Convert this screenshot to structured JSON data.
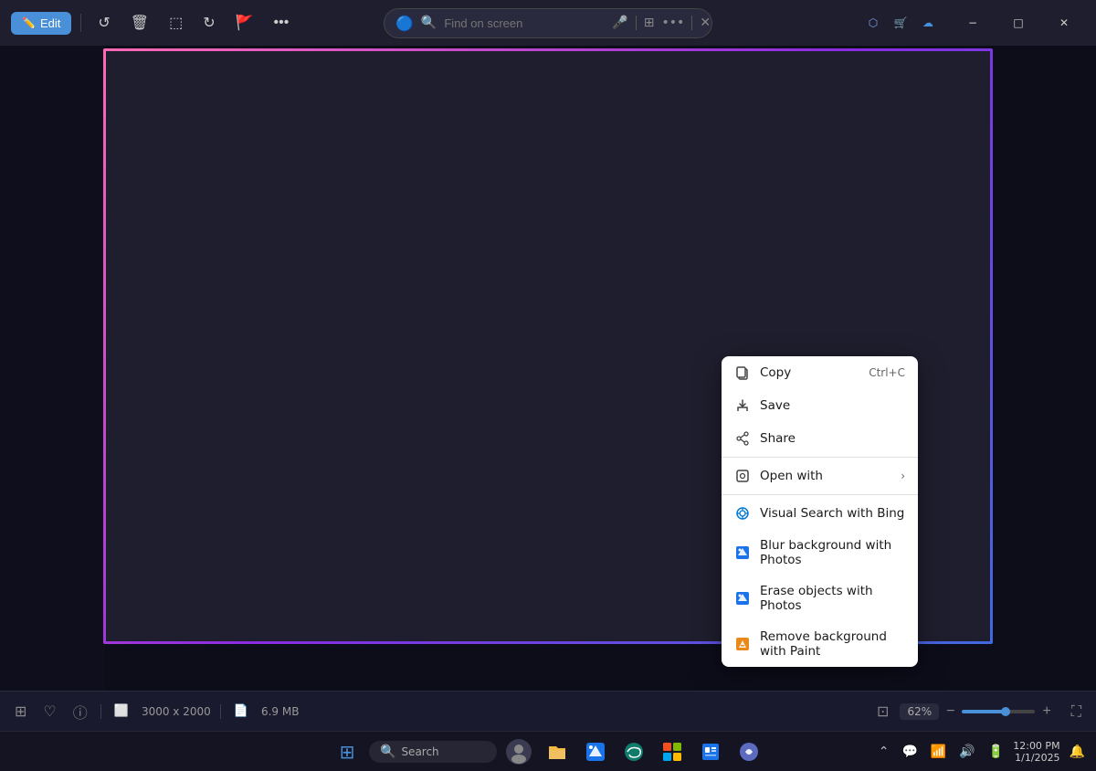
{
  "titlebar": {
    "edit_label": "Edit",
    "search_placeholder": "Find on screen",
    "toolbar_icons": [
      "rotate-left",
      "delete",
      "crop",
      "rotate-right",
      "flag",
      "more"
    ]
  },
  "window_controls": {
    "minimize": "−",
    "restore": "□",
    "close": "✕"
  },
  "statusbar": {
    "dimensions": "3000 x 2000",
    "filesize": "6.9 MB",
    "zoom_value": "62%"
  },
  "context_menu": {
    "items": [
      {
        "id": "copy",
        "label": "Copy",
        "shortcut": "Ctrl+C",
        "icon": "copy-icon"
      },
      {
        "id": "save",
        "label": "Save",
        "shortcut": "",
        "icon": "save-icon"
      },
      {
        "id": "share",
        "label": "Share",
        "shortcut": "",
        "icon": "share-icon"
      },
      {
        "id": "open-with",
        "label": "Open with",
        "shortcut": "",
        "icon": "open-with-icon",
        "arrow": "›"
      },
      {
        "id": "visual-search",
        "label": "Visual Search with Bing",
        "shortcut": "",
        "icon": "bing-icon"
      },
      {
        "id": "blur-bg",
        "label": "Blur background with Photos",
        "shortcut": "",
        "icon": "photos-icon"
      },
      {
        "id": "erase-objects",
        "label": "Erase objects with Photos",
        "shortcut": "",
        "icon": "photos-icon2"
      },
      {
        "id": "remove-bg",
        "label": "Remove background with Paint",
        "shortcut": "",
        "icon": "paint-icon"
      }
    ]
  },
  "taskbar": {
    "search_placeholder": "Search",
    "icons": [
      "windows",
      "search",
      "avatar",
      "files",
      "photos-app",
      "edge",
      "store",
      "news"
    ]
  }
}
